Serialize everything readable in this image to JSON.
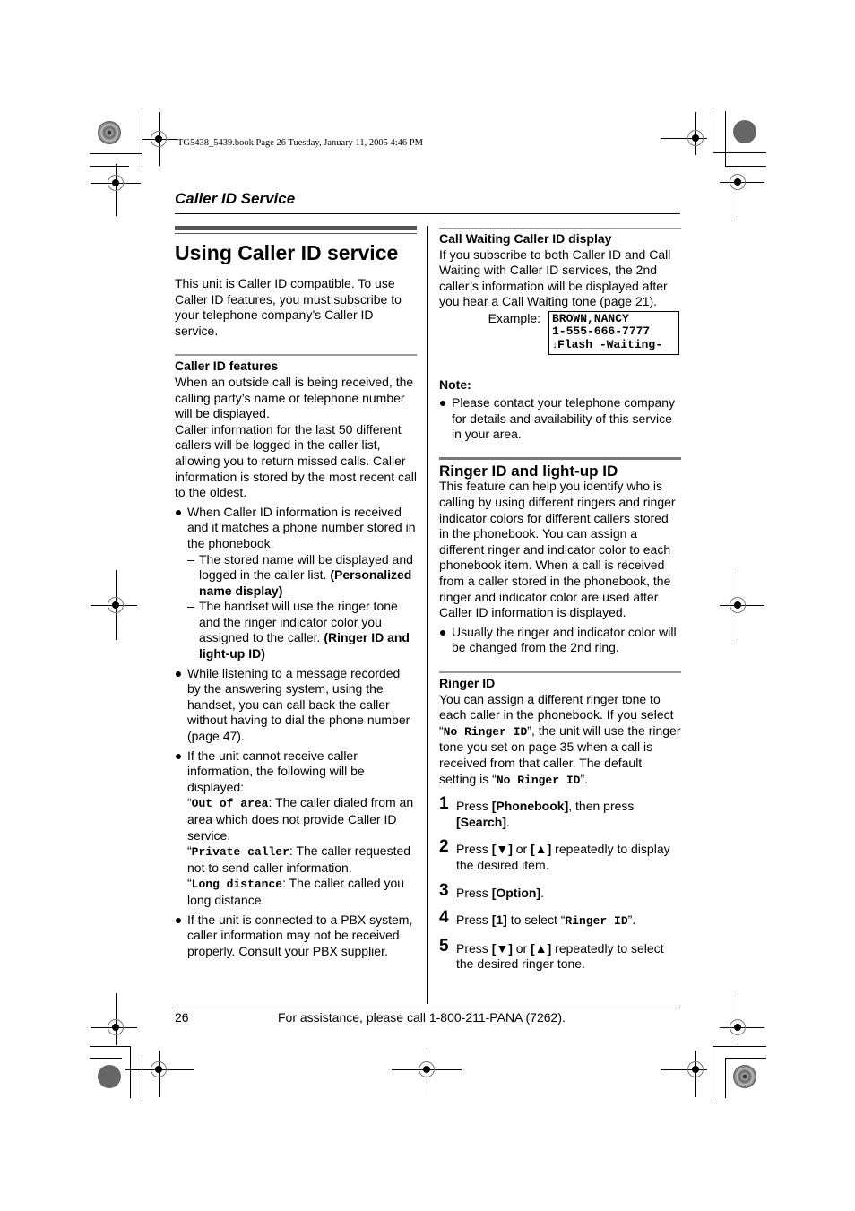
{
  "running_head": "TG5438_5439.book  Page 26  Tuesday, January 11, 2005  4:46 PM",
  "section_title": "Caller ID Service",
  "left": {
    "heading": "Using Caller ID service",
    "intro": "This unit is Caller ID compatible. To use Caller ID features, you must subscribe to your telephone company’s Caller ID service.",
    "features_heading": "Caller ID features",
    "features_p1": "When an outside call is being received, the calling party’s name or telephone number will be displayed.",
    "features_p2": "Caller information for the last 50 different callers will be logged in the caller list, allowing you to return missed calls. Caller information is stored by the most recent call to the oldest.",
    "bullet1": "When Caller ID information is received and it matches a phone number stored in the phonebook:",
    "dash1_text": "The stored name will be displayed and logged in the caller list. ",
    "dash1_bold": "(Personalized name display)",
    "dash2_text": "The handset will use the ringer tone and the ringer indicator color you assigned to the caller. ",
    "dash2_bold": "(Ringer ID and light-up ID)",
    "bullet2": "While listening to a message recorded by the answering system, using the handset, you can call back the caller without having to dial the phone number (page 47).",
    "bullet3": "If the unit cannot receive caller information, the following will be displayed:",
    "out_of_area_code": "Out of area",
    "out_of_area_desc": ": The caller dialed from an area which does not provide Caller ID service.",
    "private_code": "Private caller",
    "private_desc": ": The caller requested not to send caller information.",
    "long_code": "Long distance",
    "long_desc": ": The caller called you long distance.",
    "bullet4": "If the unit is connected to a PBX system, caller information may not be received properly. Consult your PBX supplier."
  },
  "right": {
    "cw_heading": "Call Waiting Caller ID display",
    "cw_text": "If you subscribe to both Caller ID and Call Waiting with Caller ID services, the 2nd caller’s information will be displayed after you hear a Call Waiting tone (page 21).",
    "example_label": "Example:",
    "lcd_lines": [
      "BROWN,NANCY",
      "1-555-666-7777",
      "Flash -Waiting-"
    ],
    "lcd_arrow": "↓",
    "note_label": "Note:",
    "note_bullet": "Please contact your telephone company for details and availability of this service in your area.",
    "ringer_light_heading": "Ringer ID and light-up ID",
    "ringer_light_text": "This feature can help you identify who is calling by using different ringers and ringer indicator colors for different callers stored in the phonebook. You can assign a different ringer and indicator color to each phonebook item. When a call is received from a caller stored in the phonebook, the ringer and indicator color are used after Caller ID information is displayed.",
    "ringer_light_bullet": "Usually the ringer and indicator color will be changed from the 2nd ring.",
    "ringer_id_heading": "Ringer ID",
    "ringer_id_t1": "You can assign a different ringer tone to each caller in the phonebook. If you select “",
    "ringer_id_code": "No Ringer ID",
    "ringer_id_t2": "”, the unit will use the ringer tone you set on page 35 when a call is received from that caller. The default setting is “",
    "ringer_id_t3": "”.",
    "steps": [
      {
        "num": "1",
        "press": "Press ",
        "key1": "[Phonebook]",
        "mid": ", then press ",
        "key2": "[Search]",
        "end": "."
      },
      {
        "num": "2",
        "press": "Press ",
        "key1": "[▼]",
        "mid": " or ",
        "key2": "[▲]",
        "end": " repeatedly to display the desired item."
      },
      {
        "num": "3",
        "press": "Press ",
        "key1": "[Option]",
        "end": "."
      },
      {
        "num": "4",
        "press": "Press ",
        "key1": "[1]",
        "mid": " to select “",
        "code": "Ringer ID",
        "end": "”."
      },
      {
        "num": "5",
        "press": "Press ",
        "key1": "[▼]",
        "mid": " or ",
        "key2": "[▲]",
        "end": " repeatedly to select the desired ringer tone."
      }
    ]
  },
  "footer": {
    "page_number": "26",
    "assistance": "For assistance, please call 1-800-211-PANA (7262)."
  }
}
